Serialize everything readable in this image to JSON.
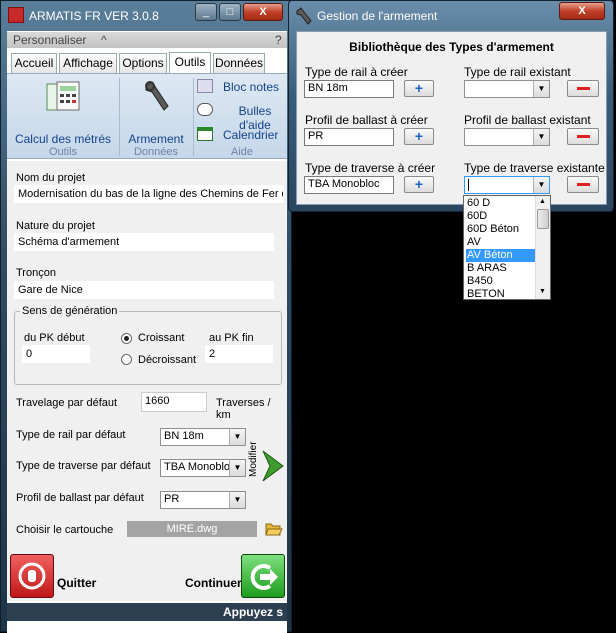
{
  "main": {
    "title": "ARMATIS FR VER 3.0.8",
    "window_buttons": {
      "minimize": "_",
      "maximize": "□",
      "close": "X"
    },
    "customize_label": "Personnaliser",
    "customize_caret": "^",
    "help_mark": "?",
    "tabs": [
      {
        "label": "Accueil"
      },
      {
        "label": "Affichage"
      },
      {
        "label": "Options"
      },
      {
        "label": "Outils",
        "active": true
      },
      {
        "label": "Données"
      }
    ],
    "ribbon": {
      "calc_label": "Calcul des métrés",
      "armement_label": "Armement",
      "bloc_notes_label": "Bloc notes",
      "bulles_label": "Bulles d'aide",
      "calendrier_label": "Calendrier",
      "groups": [
        "Outils",
        "Données",
        "Aide"
      ]
    },
    "form": {
      "nom_projet_label": "Nom du projet",
      "nom_projet_value": "Modernisation du bas de la ligne des Chemins de Fer d",
      "nature_label": "Nature du projet",
      "nature_value": "Schéma d'armement",
      "troncon_label": "Tronçon",
      "troncon_value": "Gare de Nice",
      "sens_title": "Sens de génération",
      "pk_debut_label": "du PK début",
      "pk_debut_value": "0",
      "croissant_label": "Croissant",
      "decroissant_label": "Décroissant",
      "pk_fin_label": "au PK fin",
      "pk_fin_value": "2",
      "travelage_label": "Travelage par défaut",
      "travelage_value": "1660",
      "travelage_unit": "Traverses / km",
      "rail_label": "Type de rail par défaut",
      "rail_value": "BN 18m",
      "traverse_label": "Type de traverse par défaut",
      "traverse_value": "TBA Monoblo",
      "ballast_label": "Profil de ballast par défaut",
      "ballast_value": "PR",
      "modifier_label": "Modifier",
      "cartouche_label": "Choisir le cartouche",
      "cartouche_value": "MIRE.dwg",
      "quitter_label": "Quitter",
      "continuer_label": "Continuer"
    },
    "status_text": "Appuyez s"
  },
  "dialog": {
    "title": "Gestion de l'armement",
    "close": "X",
    "heading": "Bibliothèque des Types d'armement",
    "rail_create_label": "Type de rail à créer",
    "rail_create_value": "BN 18m",
    "rail_existing_label": "Type de rail existant",
    "ballast_create_label": "Profil de ballast à créer",
    "ballast_create_value": "PR",
    "ballast_existing_label": "Profil de ballast existant",
    "traverse_create_label": "Type de traverse à créer",
    "traverse_create_value": "TBA Monobloc",
    "traverse_existing_label": "Type de traverse  existante",
    "plus": "+",
    "dropdown_items": [
      "60 D",
      "60D",
      "60D Béton",
      "AV",
      "AV Béton",
      "B ARAS",
      "B450",
      "BETON"
    ],
    "dropdown_selected": "AV Béton"
  },
  "colors": {
    "accent": "#3399ff",
    "ribbon": "#c5d7ea",
    "title_bar": "#3a5c78",
    "status": "#2b3f50"
  }
}
